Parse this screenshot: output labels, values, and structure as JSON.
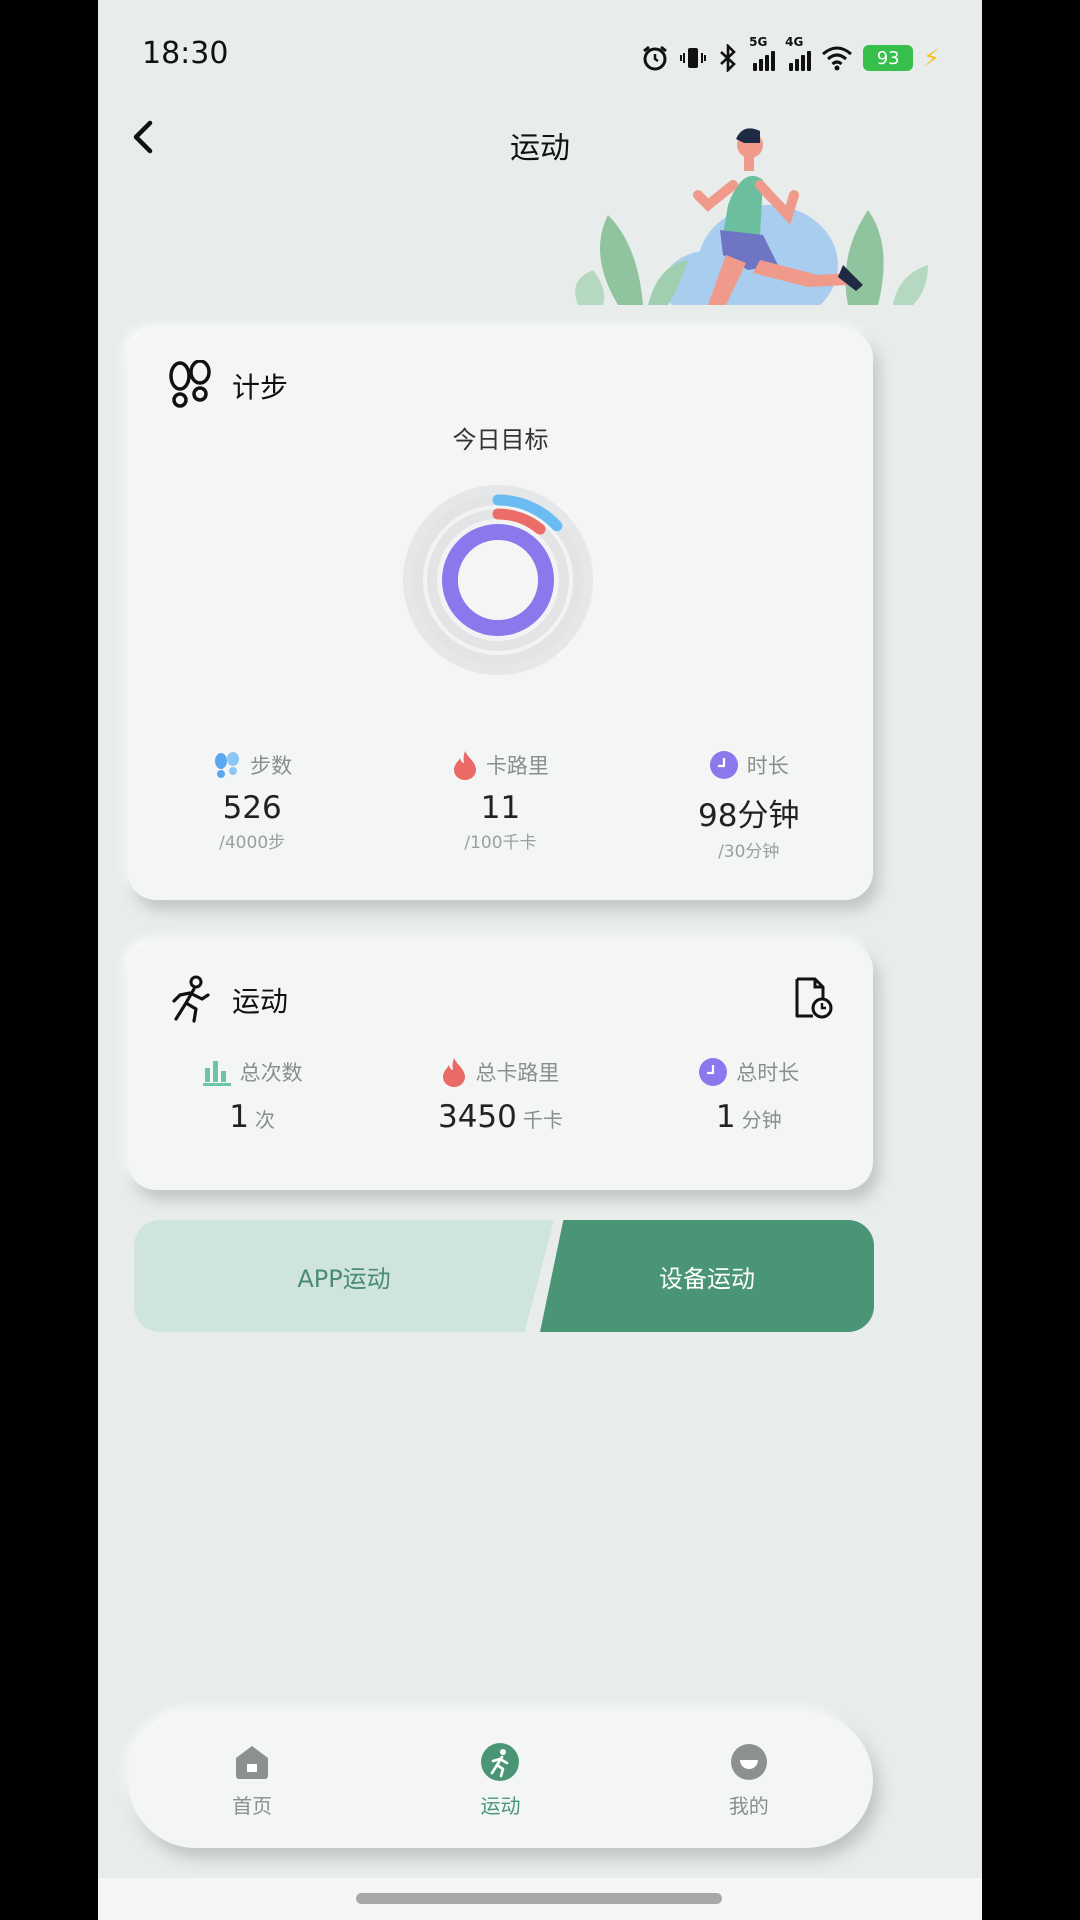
{
  "status_bar": {
    "time": "18:30",
    "signal_1_tag": "5G",
    "signal_2_tag": "4G",
    "battery": "93",
    "icons": [
      "alarm-icon",
      "vibrate-icon",
      "bluetooth-icon",
      "signal-5g-icon",
      "signal-4g-icon",
      "wifi-icon",
      "battery-icon",
      "charging-icon"
    ]
  },
  "header": {
    "title": "运动",
    "back_icon": "chevron-left-icon"
  },
  "step_card": {
    "title": "计步",
    "goal_label": "今日目标",
    "stats": [
      {
        "label": "步数",
        "value": "526",
        "sub": "/4000步",
        "icon": "footprints-icon",
        "color": "#5aa8ee"
      },
      {
        "label": "卡路里",
        "value": "11",
        "sub": "/100千卡",
        "icon": "flame-icon",
        "color": "#ea6a66"
      },
      {
        "label": "时长",
        "value": "98分钟",
        "sub": "/30分钟",
        "icon": "clock-icon",
        "color": "#8a78ec"
      }
    ],
    "rings": {
      "steps_progress": 0.1315,
      "calories_progress": 0.11,
      "duration_progress": 1.0,
      "colors": {
        "steps": "#6bbcf2",
        "calories": "#ec6d68",
        "duration": "#8a78ec",
        "track": "#e3e4e6"
      }
    }
  },
  "exercise_card": {
    "title": "运动",
    "stats": [
      {
        "label": "总次数",
        "value": "1",
        "unit": "次",
        "icon": "bar-chart-icon",
        "color": "#6cc3a6"
      },
      {
        "label": "总卡路里",
        "value": "3450",
        "unit": "千卡",
        "icon": "flame-icon",
        "color": "#ea6a66"
      },
      {
        "label": "总时长",
        "value": "1",
        "unit": "分钟",
        "icon": "clock-icon",
        "color": "#8a78ec"
      }
    ]
  },
  "segments": {
    "left": "APP运动",
    "right": "设备运动"
  },
  "bottom_nav": {
    "items": [
      {
        "label": "首页",
        "icon": "home-icon"
      },
      {
        "label": "运动",
        "icon": "running-icon",
        "active": true
      },
      {
        "label": "我的",
        "icon": "profile-icon"
      }
    ]
  },
  "colors": {
    "accent": "#4a9576",
    "accent_light": "#cfe4de",
    "background": "#e8edeb",
    "card": "#f4f6f5"
  }
}
